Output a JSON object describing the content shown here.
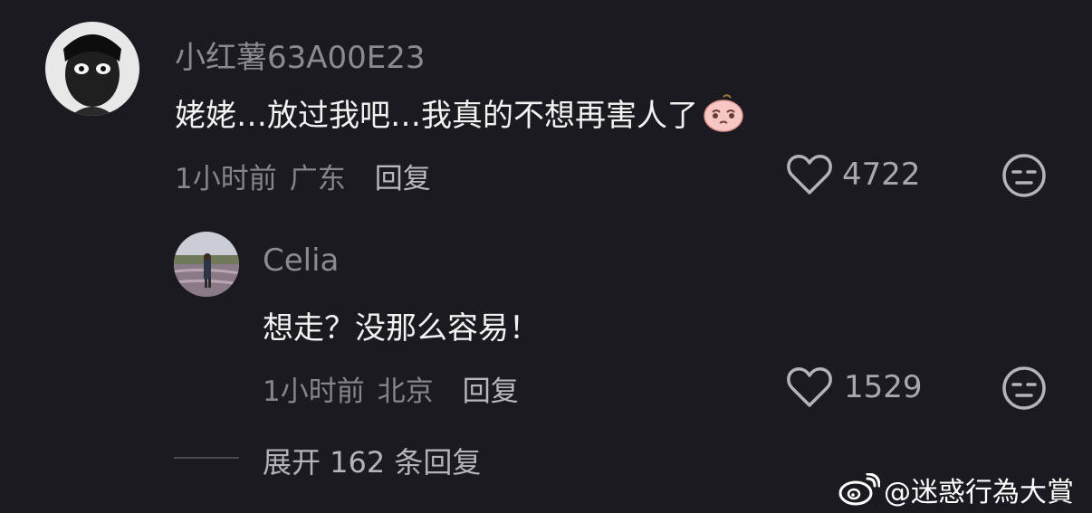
{
  "comment": {
    "username": "小红薯63A00E23",
    "text": "姥姥…放过我吧…我真的不想再害人了",
    "time": "1小时前",
    "location": "广东",
    "reply_label": "回复",
    "like_count": "4722",
    "icons": {
      "like": "heart-outline-icon",
      "dislike": "meh-face-icon",
      "emoji": "pleading-face-emoji-icon"
    }
  },
  "reply": {
    "username": "Celia",
    "text": "想走？没那么容易！",
    "time": "1小时前",
    "location": "北京",
    "reply_label": "回复",
    "like_count": "1529"
  },
  "expand": {
    "label": "展开 162 条回复"
  },
  "watermark": {
    "text": "@迷惑行為大賞",
    "icon": "weibo-logo-icon"
  },
  "colors": {
    "background": "#1b1a20",
    "text_primary": "#f2f2f2",
    "text_secondary": "#8b8a90"
  }
}
